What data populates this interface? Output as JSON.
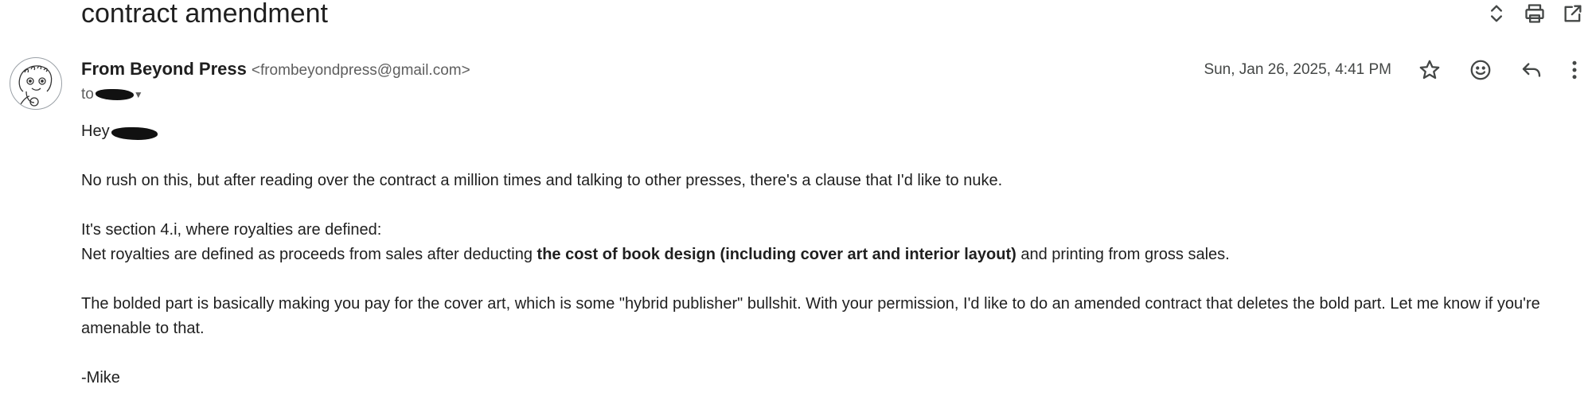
{
  "subject": "contract amendment",
  "sender": {
    "name": "From Beyond Press",
    "email": "<frombeyondpress@gmail.com>"
  },
  "to_prefix": "to",
  "date": "Sun, Jan 26, 2025, 4:41 PM",
  "toolbar": {
    "icons": [
      "expand-icon",
      "print-icon",
      "open-in-new-window-icon"
    ]
  },
  "actions": {
    "icons": [
      "star-icon",
      "emoji-reaction-icon",
      "reply-icon",
      "more-options-icon"
    ]
  },
  "body": {
    "greeting": "Hey",
    "para1": "No rush on this, but after reading over the contract a million times and talking to other presses, there's a clause that I'd like to nuke.",
    "para2_line1": "It's section 4.i, where royalties are defined:",
    "para2_line2_before": "Net royalties are defined as proceeds from sales after deducting ",
    "para2_line2_bold": "the cost of book design (including cover art and interior layout)",
    "para2_line2_after": " and printing from gross sales.",
    "para3": "The bolded part is basically making you pay for the cover art, which is some \"hybrid publisher\" bullshit. With your permission, I'd like to do an amended contract that deletes the bold part. Let me know if you're amenable to that.",
    "signature": "-Mike"
  }
}
